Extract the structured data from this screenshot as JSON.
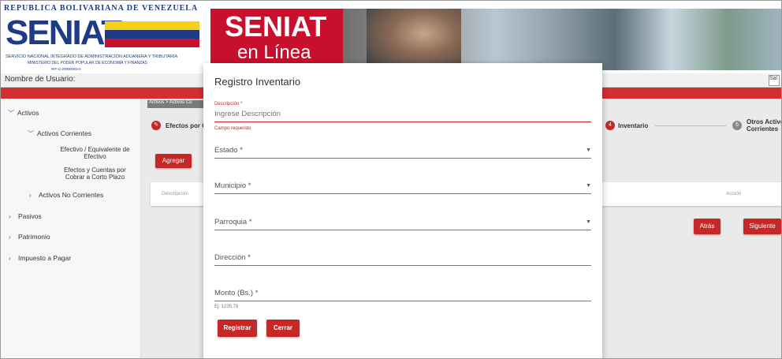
{
  "header": {
    "republic_line": "REPUBLICA BOLIVARIANA DE VENEZUELA",
    "logo_word": "SENIAT",
    "logo_line1": "SERVICIO NACIONAL INTEGRADO DE ADMINISTRACIÓN ADUANERA Y TRIBUTARIA",
    "logo_line2": "MINISTERIO DEL PODER POPULAR DE ECONOMÍA Y FINANZAS",
    "logo_line3": "RIF G-20000303-0",
    "banner_title": "SENIAT",
    "banner_subtitle": "en Línea"
  },
  "userbar": {
    "username_label": "Nombre de Usuario:",
    "exit_label": "Sal"
  },
  "sidebar": {
    "activos": "Activos",
    "activos_corrientes": "Activos Corrientes",
    "efectivo": "Efectivo / Equivalente de Efectivo",
    "efectos": "Efectos y Cuentas por Cobrar a Corto Plazo",
    "activos_no_corrientes": "Activos No Corrientes",
    "pasivos": "Pasivos",
    "patrimonio": "Patrimonio",
    "impuesto": "Impuesto a Pagar"
  },
  "main": {
    "breadcrumb": "Activos > Activos Co",
    "step_efectos": "Efectos por C",
    "step4_number": "4",
    "step4_label": "Inventario",
    "step5_number": "5",
    "step5_label_line1": "Otros Activo",
    "step5_label_line2": "Corrientes",
    "agregar_label": "Agregar",
    "col_descripcion": "Descripción",
    "col_accion": "Acción",
    "atras_label": "Atrás",
    "siguiente_label": "Siguiente"
  },
  "modal": {
    "title": "Registro Inventario",
    "descripcion_label": "Descripción *",
    "descripcion_placeholder": "Ingrese Descripción",
    "descripcion_error": "Campo requerido",
    "estado_label": "Estado *",
    "municipio_label": "Municipio *",
    "parroquia_label": "Parroquia *",
    "direccion_label": "Dirección *",
    "monto_label": "Monto (Bs.) *",
    "monto_hint": "Ej: 1235,78",
    "registrar_label": "Registrar",
    "cerrar_label": "Cerrar"
  },
  "colors": {
    "brand_red": "#c62828",
    "brand_blue": "#1f3b87",
    "flag_yellow": "#f7d117",
    "flag_blue": "#1f3b87",
    "flag_red": "#c8102e"
  }
}
